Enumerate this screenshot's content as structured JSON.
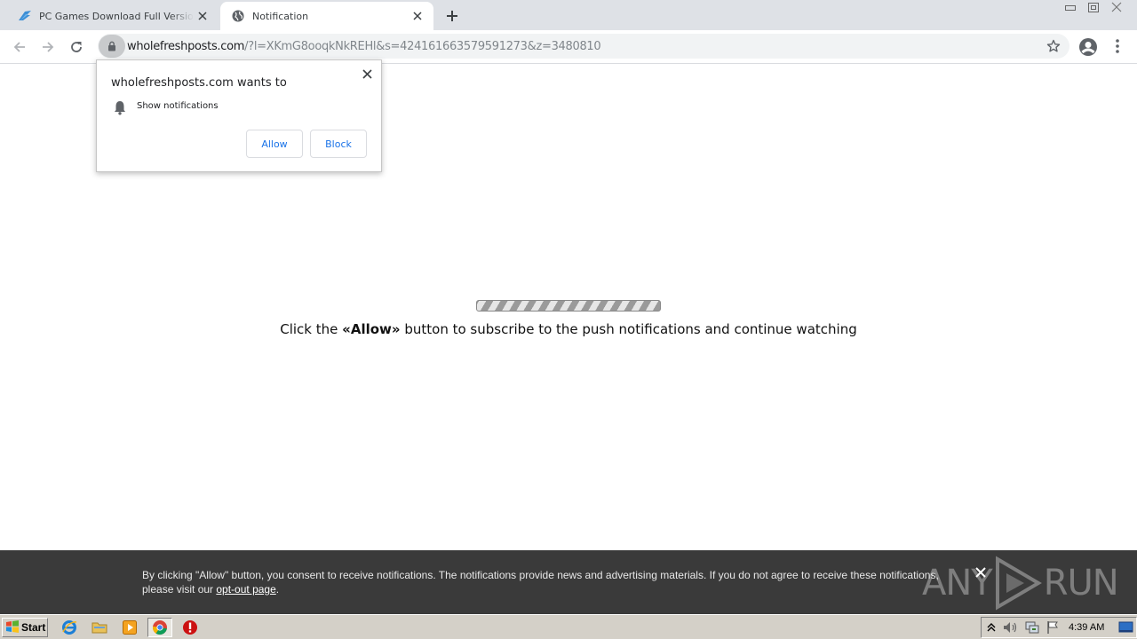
{
  "tabs": [
    {
      "title": "PC Games Download Full Version for",
      "favicon": "bird-icon",
      "active": false
    },
    {
      "title": "Notification",
      "favicon": "globe-icon",
      "active": true
    }
  ],
  "toolbar": {
    "url_host": "wholefreshposts.com",
    "url_path": "/?l=XKmG8ooqkNkREHl&s=424161663579591273&z=3480810"
  },
  "permission_bubble": {
    "title": "wholefreshposts.com wants to",
    "permission": "Show notifications",
    "allow_label": "Allow",
    "block_label": "Block"
  },
  "page": {
    "text_before": "Click the ",
    "text_bold": "«Allow»",
    "text_after": " button to subscribe to the push notifications and continue watching"
  },
  "consent": {
    "text": "By clicking \"Allow\" button, you consent to receive notifications. The notifications provide news and advertising materials. If you do not agree to receive these notifications, please visit our ",
    "link_label": "opt-out page",
    "text_end": "."
  },
  "watermark": {
    "left": "ANY",
    "right": "RUN"
  },
  "taskbar": {
    "start_label": "Start",
    "clock": "4:39 AM"
  },
  "colors": {
    "accent_blue": "#1a73e8",
    "tabstrip_bg": "#dee1e6",
    "consent_bg": "#3a3a3a",
    "taskbar_bg": "#d4d0c8"
  }
}
